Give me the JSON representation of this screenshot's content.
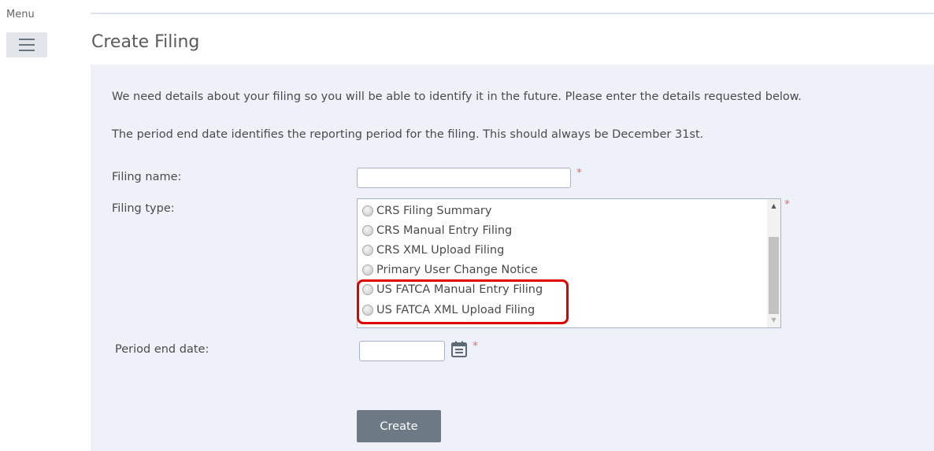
{
  "menu": {
    "label": "Menu"
  },
  "page": {
    "title": "Create Filing"
  },
  "intro": {
    "line1": "We need details about your filing so you will be able to identify it in the future. Please enter the details requested below.",
    "line2": "The period end date identifies the reporting period for the filing. This should always be December 31st."
  },
  "form": {
    "filing_name_label": "Filing name:",
    "filing_name_value": "",
    "filing_type_label": "Filing type:",
    "filing_type_options": [
      "CRS Filing Summary",
      "CRS Manual Entry Filing",
      "CRS XML Upload Filing",
      "Primary User Change Notice",
      "US FATCA Manual Entry Filing",
      "US FATCA XML Upload Filing"
    ],
    "period_end_label": "Period end date:",
    "period_end_value": "",
    "required_mark": "*",
    "create_label": "Create"
  },
  "icons": {
    "menu": "hamburger-icon",
    "calendar": "calendar-icon",
    "radio": "radio-icon",
    "scroll_up": "arrow-up-icon",
    "scroll_down": "arrow-down-icon"
  },
  "annotation": {
    "highlight_color": "#e00000",
    "highlighted_options": [
      "US FATCA Manual Entry Filing",
      "US FATCA XML Upload Filing"
    ]
  },
  "colors": {
    "panel_background": "#eef2f8",
    "button_background": "#6d7a85",
    "required_color": "#e07070"
  }
}
